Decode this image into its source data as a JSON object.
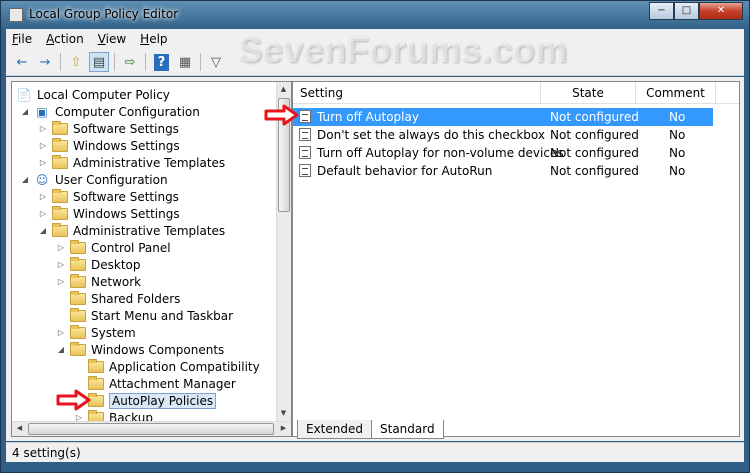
{
  "window": {
    "title": "Local Group Policy Editor",
    "watermark": "SevenForums.com"
  },
  "caption_buttons": {
    "minimize": "−",
    "maximize": "□",
    "close": "✕"
  },
  "menu": {
    "items": [
      {
        "label": "File",
        "accel": "F",
        "rest": "ile"
      },
      {
        "label": "Action",
        "accel": "A",
        "rest": "ction"
      },
      {
        "label": "View",
        "accel": "V",
        "rest": "iew"
      },
      {
        "label": "Help",
        "accel": "H",
        "rest": "elp"
      }
    ]
  },
  "toolbar": {
    "back_icon": "←",
    "forward_icon": "→",
    "up_icon": "⇧",
    "show_hide_icon": "▤",
    "export_icon": "⇨",
    "help_icon": "?",
    "properties_icon": "▦",
    "filter_icon": "▽"
  },
  "tree": {
    "items": [
      {
        "label": "Local Computer Policy",
        "level": 0
      },
      {
        "label": "Computer Configuration",
        "level": 1
      },
      {
        "label": "Software Settings",
        "level": 2
      },
      {
        "label": "Windows Settings",
        "level": 2
      },
      {
        "label": "Administrative Templates",
        "level": 2
      },
      {
        "label": "User Configuration",
        "level": 1
      },
      {
        "label": "Software Settings",
        "level": 2
      },
      {
        "label": "Windows Settings",
        "level": 2
      },
      {
        "label": "Administrative Templates",
        "level": 2
      },
      {
        "label": "Control Panel",
        "level": 3
      },
      {
        "label": "Desktop",
        "level": 3
      },
      {
        "label": "Network",
        "level": 3
      },
      {
        "label": "Shared Folders",
        "level": 3
      },
      {
        "label": "Start Menu and Taskbar",
        "level": 3
      },
      {
        "label": "System",
        "level": 3
      },
      {
        "label": "Windows Components",
        "level": 3
      },
      {
        "label": "Application Compatibility",
        "level": 4
      },
      {
        "label": "Attachment Manager",
        "level": 4
      },
      {
        "label": "AutoPlay Policies",
        "level": 4,
        "selected": true
      },
      {
        "label": "Backup",
        "level": 4
      }
    ]
  },
  "list": {
    "columns": {
      "setting": "Setting",
      "state": "State",
      "comment": "Comment"
    },
    "rows": [
      {
        "setting": "Turn off Autoplay",
        "state": "Not configured",
        "comment": "No",
        "selected": true
      },
      {
        "setting": "Don't set the always do this checkbox",
        "state": "Not configured",
        "comment": "No"
      },
      {
        "setting": "Turn off Autoplay for non-volume devices",
        "state": "Not configured",
        "comment": "No"
      },
      {
        "setting": "Default behavior for AutoRun",
        "state": "Not configured",
        "comment": "No"
      }
    ]
  },
  "tabs": {
    "extended": "Extended",
    "standard": "Standard"
  },
  "status": {
    "text": "4 setting(s)"
  },
  "colors": {
    "selection": "#3399ff",
    "annotation_arrow": "#e8141c"
  }
}
